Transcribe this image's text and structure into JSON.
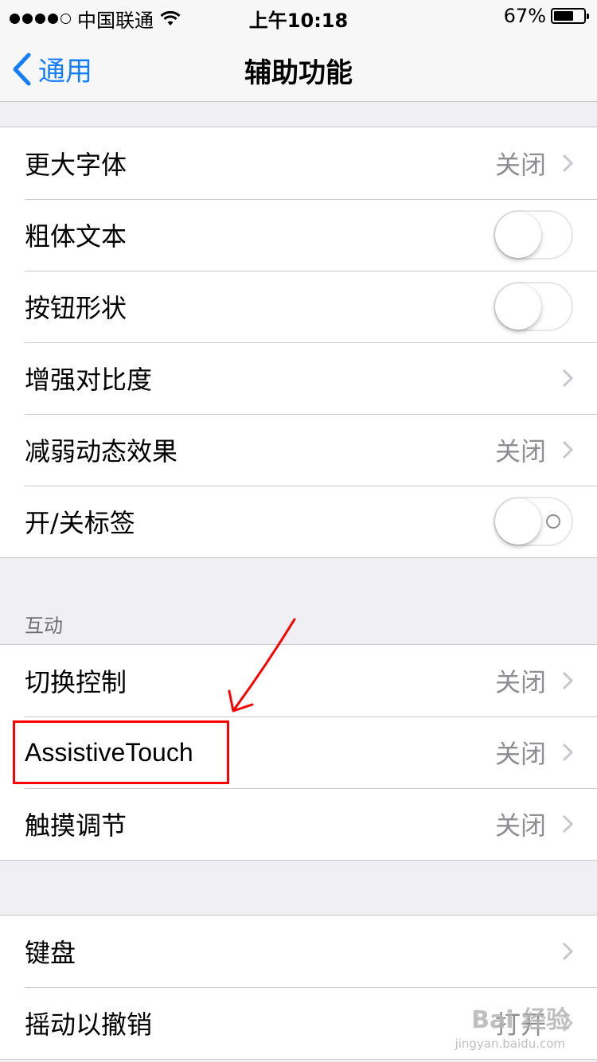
{
  "status_bar": {
    "carrier": "中国联通",
    "time": "上午10:18",
    "battery_percent": "67%",
    "signal_strength": 4,
    "battery_level": 0.67
  },
  "nav": {
    "back_label": "通用",
    "title": "辅助功能"
  },
  "accent_color": "#157efb",
  "group1": {
    "rows": [
      {
        "label": "更大字体",
        "value": "关闭",
        "control": "chevron"
      },
      {
        "label": "粗体文本",
        "control": "toggle",
        "state": "off"
      },
      {
        "label": "按钮形状",
        "control": "toggle",
        "state": "off"
      },
      {
        "label": "增强对比度",
        "control": "chevron"
      },
      {
        "label": "减弱动态效果",
        "value": "关闭",
        "control": "chevron"
      },
      {
        "label": "开/关标签",
        "control": "toggle",
        "state": "off"
      }
    ]
  },
  "section_interaction": {
    "header": "互动",
    "rows": [
      {
        "label": "切换控制",
        "value": "关闭",
        "control": "chevron"
      },
      {
        "label": "AssistiveTouch",
        "value": "关闭",
        "control": "chevron"
      },
      {
        "label": "触摸调节",
        "value": "关闭",
        "control": "chevron"
      }
    ]
  },
  "group3": {
    "rows": [
      {
        "label": "键盘",
        "control": "chevron"
      },
      {
        "label": "摇动以撤销",
        "value": "打开",
        "control": "chevron"
      }
    ]
  },
  "annotation": {
    "color": "#ff0000",
    "highlights": "AssistiveTouch"
  },
  "watermark": {
    "text": "Bai 经验",
    "sub": "jingyan.baidu.com"
  }
}
